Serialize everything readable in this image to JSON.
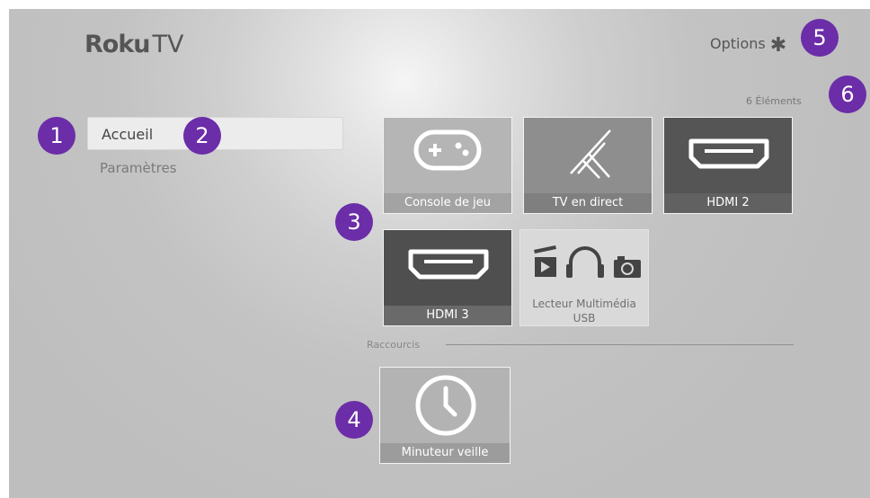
{
  "header": {
    "logo_brand": "Roku",
    "logo_suffix": "TV",
    "options_label": "Options",
    "options_icon": "asterisk-icon"
  },
  "menu": {
    "items": [
      {
        "label": "Accueil",
        "selected": true
      },
      {
        "label": "Paramètres",
        "selected": false
      }
    ]
  },
  "grid": {
    "count_label": "6 Éléments",
    "tiles": [
      {
        "label": "Console de jeu",
        "icon": "gamepad-icon"
      },
      {
        "label": "TV en direct",
        "icon": "antenna-icon"
      },
      {
        "label": "HDMI 2",
        "icon": "hdmi-icon"
      },
      {
        "label": "HDMI 3",
        "icon": "hdmi-icon"
      },
      {
        "label": "Lecteur Multimédia USB",
        "icon": "media-icon"
      }
    ]
  },
  "shortcuts": {
    "title": "Raccourcis",
    "tiles": [
      {
        "label": "Minuteur veille",
        "icon": "clock-icon"
      }
    ]
  },
  "callouts": [
    "1",
    "2",
    "3",
    "4",
    "5",
    "6"
  ],
  "colors": {
    "callout": "#6b2da8",
    "background": "#bebebe"
  }
}
